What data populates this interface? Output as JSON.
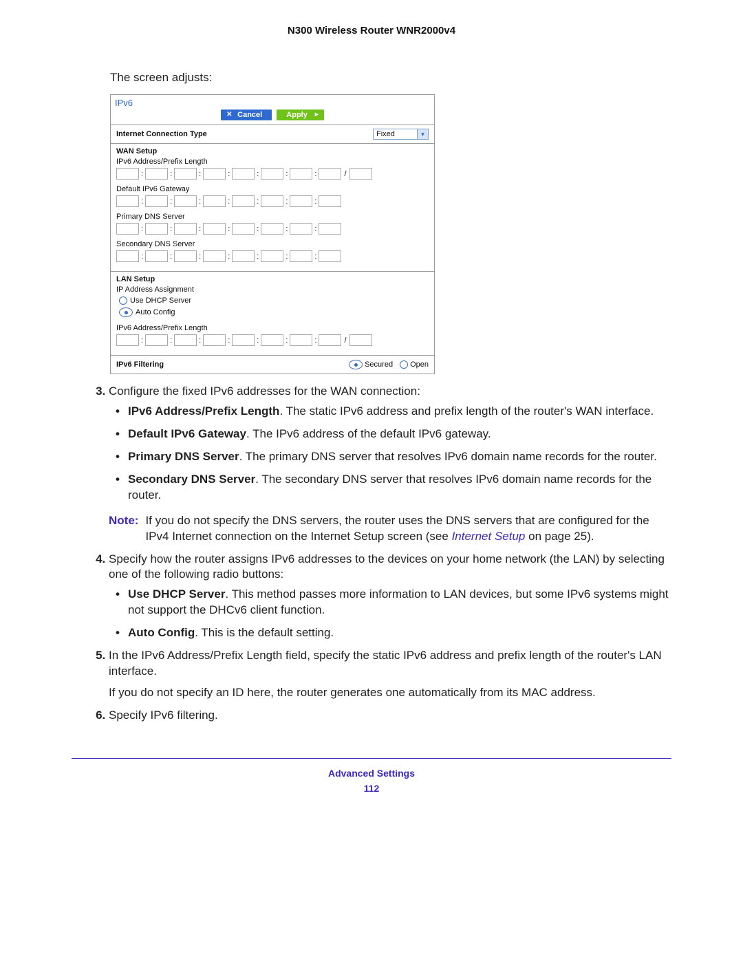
{
  "header": {
    "title": "N300 Wireless Router WNR2000v4"
  },
  "intro": "The screen adjusts:",
  "ui": {
    "title": "IPv6",
    "cancel": "Cancel",
    "apply": "Apply",
    "connTypeLabel": "Internet Connection Type",
    "connTypeValue": "Fixed",
    "wan": {
      "heading": "WAN Setup",
      "addrPrefix": "IPv6 Address/Prefix Length",
      "gateway": "Default IPv6 Gateway",
      "primaryDNS": "Primary DNS Server",
      "secondaryDNS": "Secondary DNS Server"
    },
    "lan": {
      "heading": "LAN Setup",
      "assign": "IP Address Assignment",
      "dhcp": "Use DHCP Server",
      "auto": "Auto Config",
      "addrPrefix": "IPv6 Address/Prefix Length"
    },
    "filter": {
      "label": "IPv6 Filtering",
      "secured": "Secured",
      "open": "Open"
    }
  },
  "steps": {
    "s3": {
      "lead": "Configure the fixed IPv6 addresses for the WAN connection:",
      "bul1_b": "IPv6 Address/Prefix Length",
      "bul1_t": ". The static IPv6 address and prefix length of the router's WAN interface.",
      "bul2_b": "Default IPv6 Gateway",
      "bul2_t": ". The IPv6 address of the default IPv6 gateway.",
      "bul3_b": "Primary DNS Server",
      "bul3_t": ". The primary DNS server that resolves IPv6 domain name records for the router.",
      "bul4_b": "Secondary DNS Server",
      "bul4_t": ". The secondary DNS server that resolves IPv6 domain name records for the router.",
      "note_lbl": "Note:",
      "note_t1": "If you do not specify the DNS servers, the router uses the DNS servers that are configured for the IPv4 Internet connection on the Internet Setup screen (see ",
      "note_link": "Internet Setup",
      "note_t2": " on page 25)."
    },
    "s4": {
      "lead": "Specify how the router assigns IPv6 addresses to the devices on your home network (the LAN) by selecting one of the following radio buttons:",
      "bul1_b": "Use DHCP Server",
      "bul1_t": ". This method passes more information to LAN devices, but some IPv6 systems might not support the DHCv6 client function.",
      "bul2_b": "Auto Config",
      "bul2_t": ". This is the default setting."
    },
    "s5": {
      "lead": "In the IPv6 Address/Prefix Length field, specify the static IPv6 address and prefix length of the router's LAN interface.",
      "para": "If you do not specify an ID here, the router generates one automatically from its MAC address."
    },
    "s6": {
      "lead": "Specify IPv6 filtering."
    }
  },
  "footer": {
    "section": "Advanced Settings",
    "page": "112"
  }
}
